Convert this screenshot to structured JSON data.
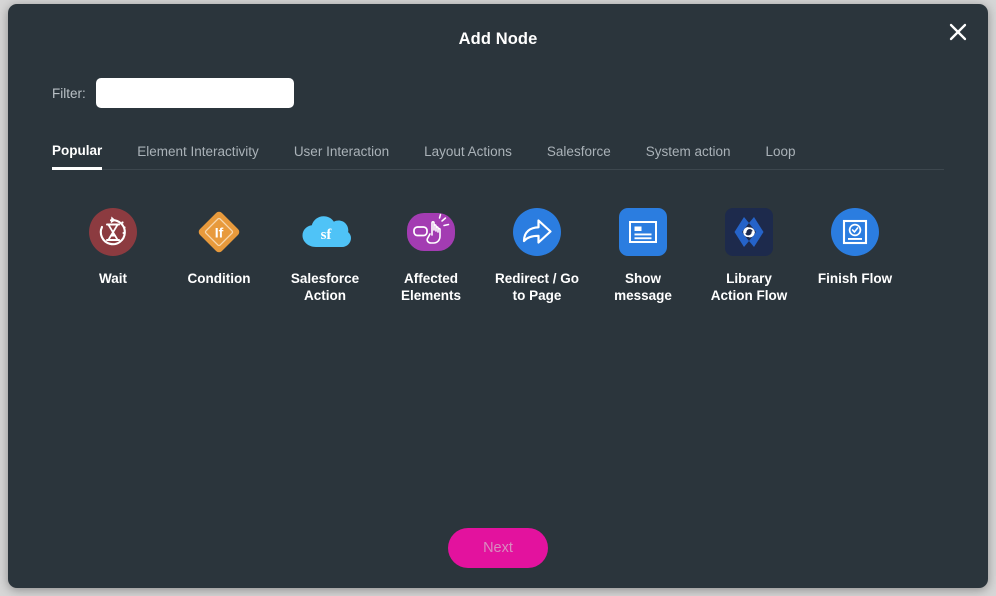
{
  "modal": {
    "title": "Add Node",
    "close_icon": "close-icon"
  },
  "filter": {
    "label": "Filter:",
    "value": "",
    "placeholder": ""
  },
  "tabs": [
    {
      "label": "Popular",
      "active": true
    },
    {
      "label": "Element Interactivity",
      "active": false
    },
    {
      "label": "User Interaction",
      "active": false
    },
    {
      "label": "Layout Actions",
      "active": false
    },
    {
      "label": "Salesforce",
      "active": false
    },
    {
      "label": "System action",
      "active": false
    },
    {
      "label": "Loop",
      "active": false
    }
  ],
  "nodes": [
    {
      "label": "Wait",
      "icon": "wait-hourglass-icon",
      "color": "#8c3b40"
    },
    {
      "label": "Condition",
      "icon": "condition-diamond-if-icon",
      "color": "#e89a3c"
    },
    {
      "label": "Salesforce\nAction",
      "icon": "salesforce-cloud-sf-icon",
      "color": "#4fc3f7"
    },
    {
      "label": "Affected\nElements",
      "icon": "cursor-on-button-icon",
      "color": "#a33cb2"
    },
    {
      "label": "Redirect / Go\nto Page",
      "icon": "forward-arrow-icon",
      "color": "#2b7de0"
    },
    {
      "label": "Show\nmessage",
      "icon": "message-document-icon",
      "color": "#2b7de0"
    },
    {
      "label": "Library\nAction Flow",
      "icon": "code-brackets-refresh-icon",
      "color": "#1d2a4c"
    },
    {
      "label": "Finish Flow",
      "icon": "finish-check-square-icon",
      "color": "#2b7de0"
    }
  ],
  "footer": {
    "next_label": "Next",
    "next_color": "#e3129e"
  }
}
